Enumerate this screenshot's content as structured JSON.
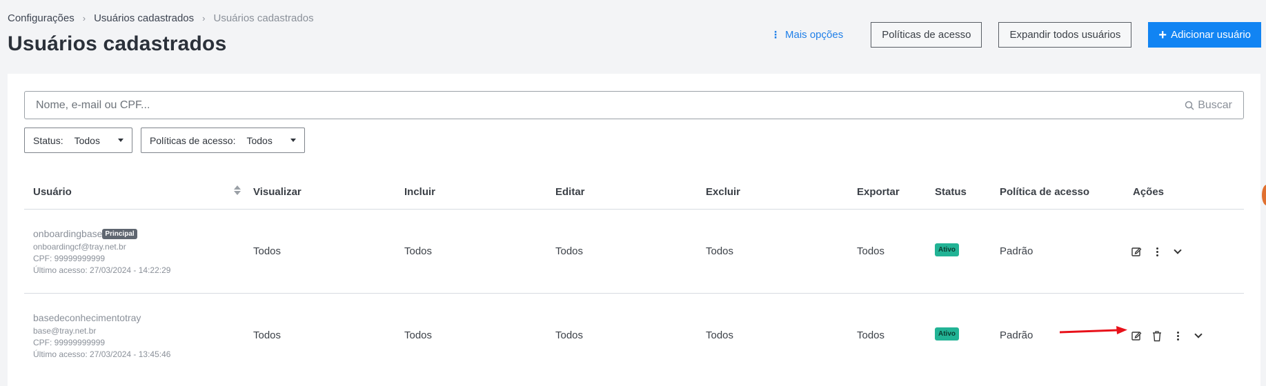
{
  "breadcrumb": {
    "item1": "Configurações",
    "item2": "Usuários cadastrados",
    "current": "Usuários cadastrados"
  },
  "page": {
    "title": "Usuários cadastrados"
  },
  "actions": {
    "more_options": "Mais opções",
    "access_policies": "Políticas de acesso",
    "expand_all": "Expandir todos usuários",
    "add_user": "Adicionar usuário"
  },
  "search": {
    "placeholder": "Nome, e-mail ou CPF...",
    "button": "Buscar"
  },
  "filters": {
    "status": {
      "label": "Status:",
      "value": "Todos"
    },
    "policy": {
      "label": "Políticas de acesso:",
      "value": "Todos"
    }
  },
  "table": {
    "headers": {
      "user": "Usuário",
      "view": "Visualizar",
      "include": "Incluir",
      "edit": "Editar",
      "delete": "Excluir",
      "export": "Exportar",
      "status": "Status",
      "policy": "Política de acesso",
      "actions": "Ações"
    },
    "rows": [
      {
        "username": "onboardingbase",
        "tag": "Principal",
        "email": "onboardingcf@tray.net.br",
        "cpf": "CPF: 99999999999",
        "last_access": "Último acesso:  27/03/2024 - 14:22:29",
        "view": "Todos",
        "include": "Todos",
        "edit": "Todos",
        "delete": "Todos",
        "export": "Todos",
        "status": "Ativo",
        "policy": "Padrão"
      },
      {
        "username": "basedeconhecimentotray",
        "email": "base@tray.net.br",
        "cpf": "CPF: 99999999999",
        "last_access": "Último acesso:  27/03/2024 - 13:45:46",
        "view": "Todos",
        "include": "Todos",
        "edit": "Todos",
        "delete": "Todos",
        "export": "Todos",
        "status": "Ativo",
        "policy": "Padrão"
      }
    ]
  },
  "colors": {
    "primary": "#1184f3",
    "link": "#1f7fe8",
    "status_active": "#22b395",
    "annotation_arrow": "#e8111a"
  }
}
